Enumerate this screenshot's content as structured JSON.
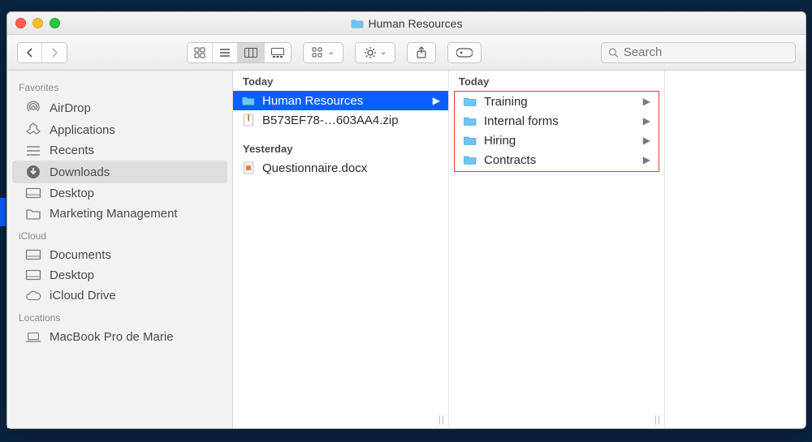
{
  "window": {
    "title": "Human Resources"
  },
  "search": {
    "placeholder": "Search"
  },
  "sidebar": {
    "sections": [
      {
        "title": "Favorites",
        "items": [
          {
            "icon": "airdrop",
            "label": "AirDrop"
          },
          {
            "icon": "apps",
            "label": "Applications"
          },
          {
            "icon": "recents",
            "label": "Recents"
          },
          {
            "icon": "downloads",
            "label": "Downloads",
            "selected": true
          },
          {
            "icon": "desktop",
            "label": "Desktop"
          },
          {
            "icon": "folder",
            "label": "Marketing Management"
          }
        ]
      },
      {
        "title": "iCloud",
        "items": [
          {
            "icon": "desktop",
            "label": "Documents"
          },
          {
            "icon": "desktop",
            "label": "Desktop"
          },
          {
            "icon": "cloud",
            "label": "iCloud Drive"
          }
        ]
      },
      {
        "title": "Locations",
        "items": [
          {
            "icon": "laptop",
            "label": "MacBook Pro de Marie"
          }
        ]
      }
    ]
  },
  "columns": [
    {
      "groups": [
        {
          "header": "Today",
          "items": [
            {
              "kind": "folder",
              "label": "Human Resources",
              "selected": true,
              "chevron": true
            },
            {
              "kind": "zip",
              "label": "B573EF78-…603AA4.zip"
            }
          ]
        },
        {
          "header": "Yesterday",
          "items": [
            {
              "kind": "doc",
              "label": "Questionnaire.docx"
            }
          ]
        }
      ]
    },
    {
      "highlighted": true,
      "groups": [
        {
          "header": "Today",
          "items": [
            {
              "kind": "folder",
              "label": "Training",
              "chevron": true
            },
            {
              "kind": "folder",
              "label": "Internal forms",
              "chevron": true
            },
            {
              "kind": "folder",
              "label": "Hiring",
              "chevron": true
            },
            {
              "kind": "folder",
              "label": "Contracts",
              "chevron": true
            }
          ]
        }
      ]
    },
    {
      "groups": []
    }
  ]
}
